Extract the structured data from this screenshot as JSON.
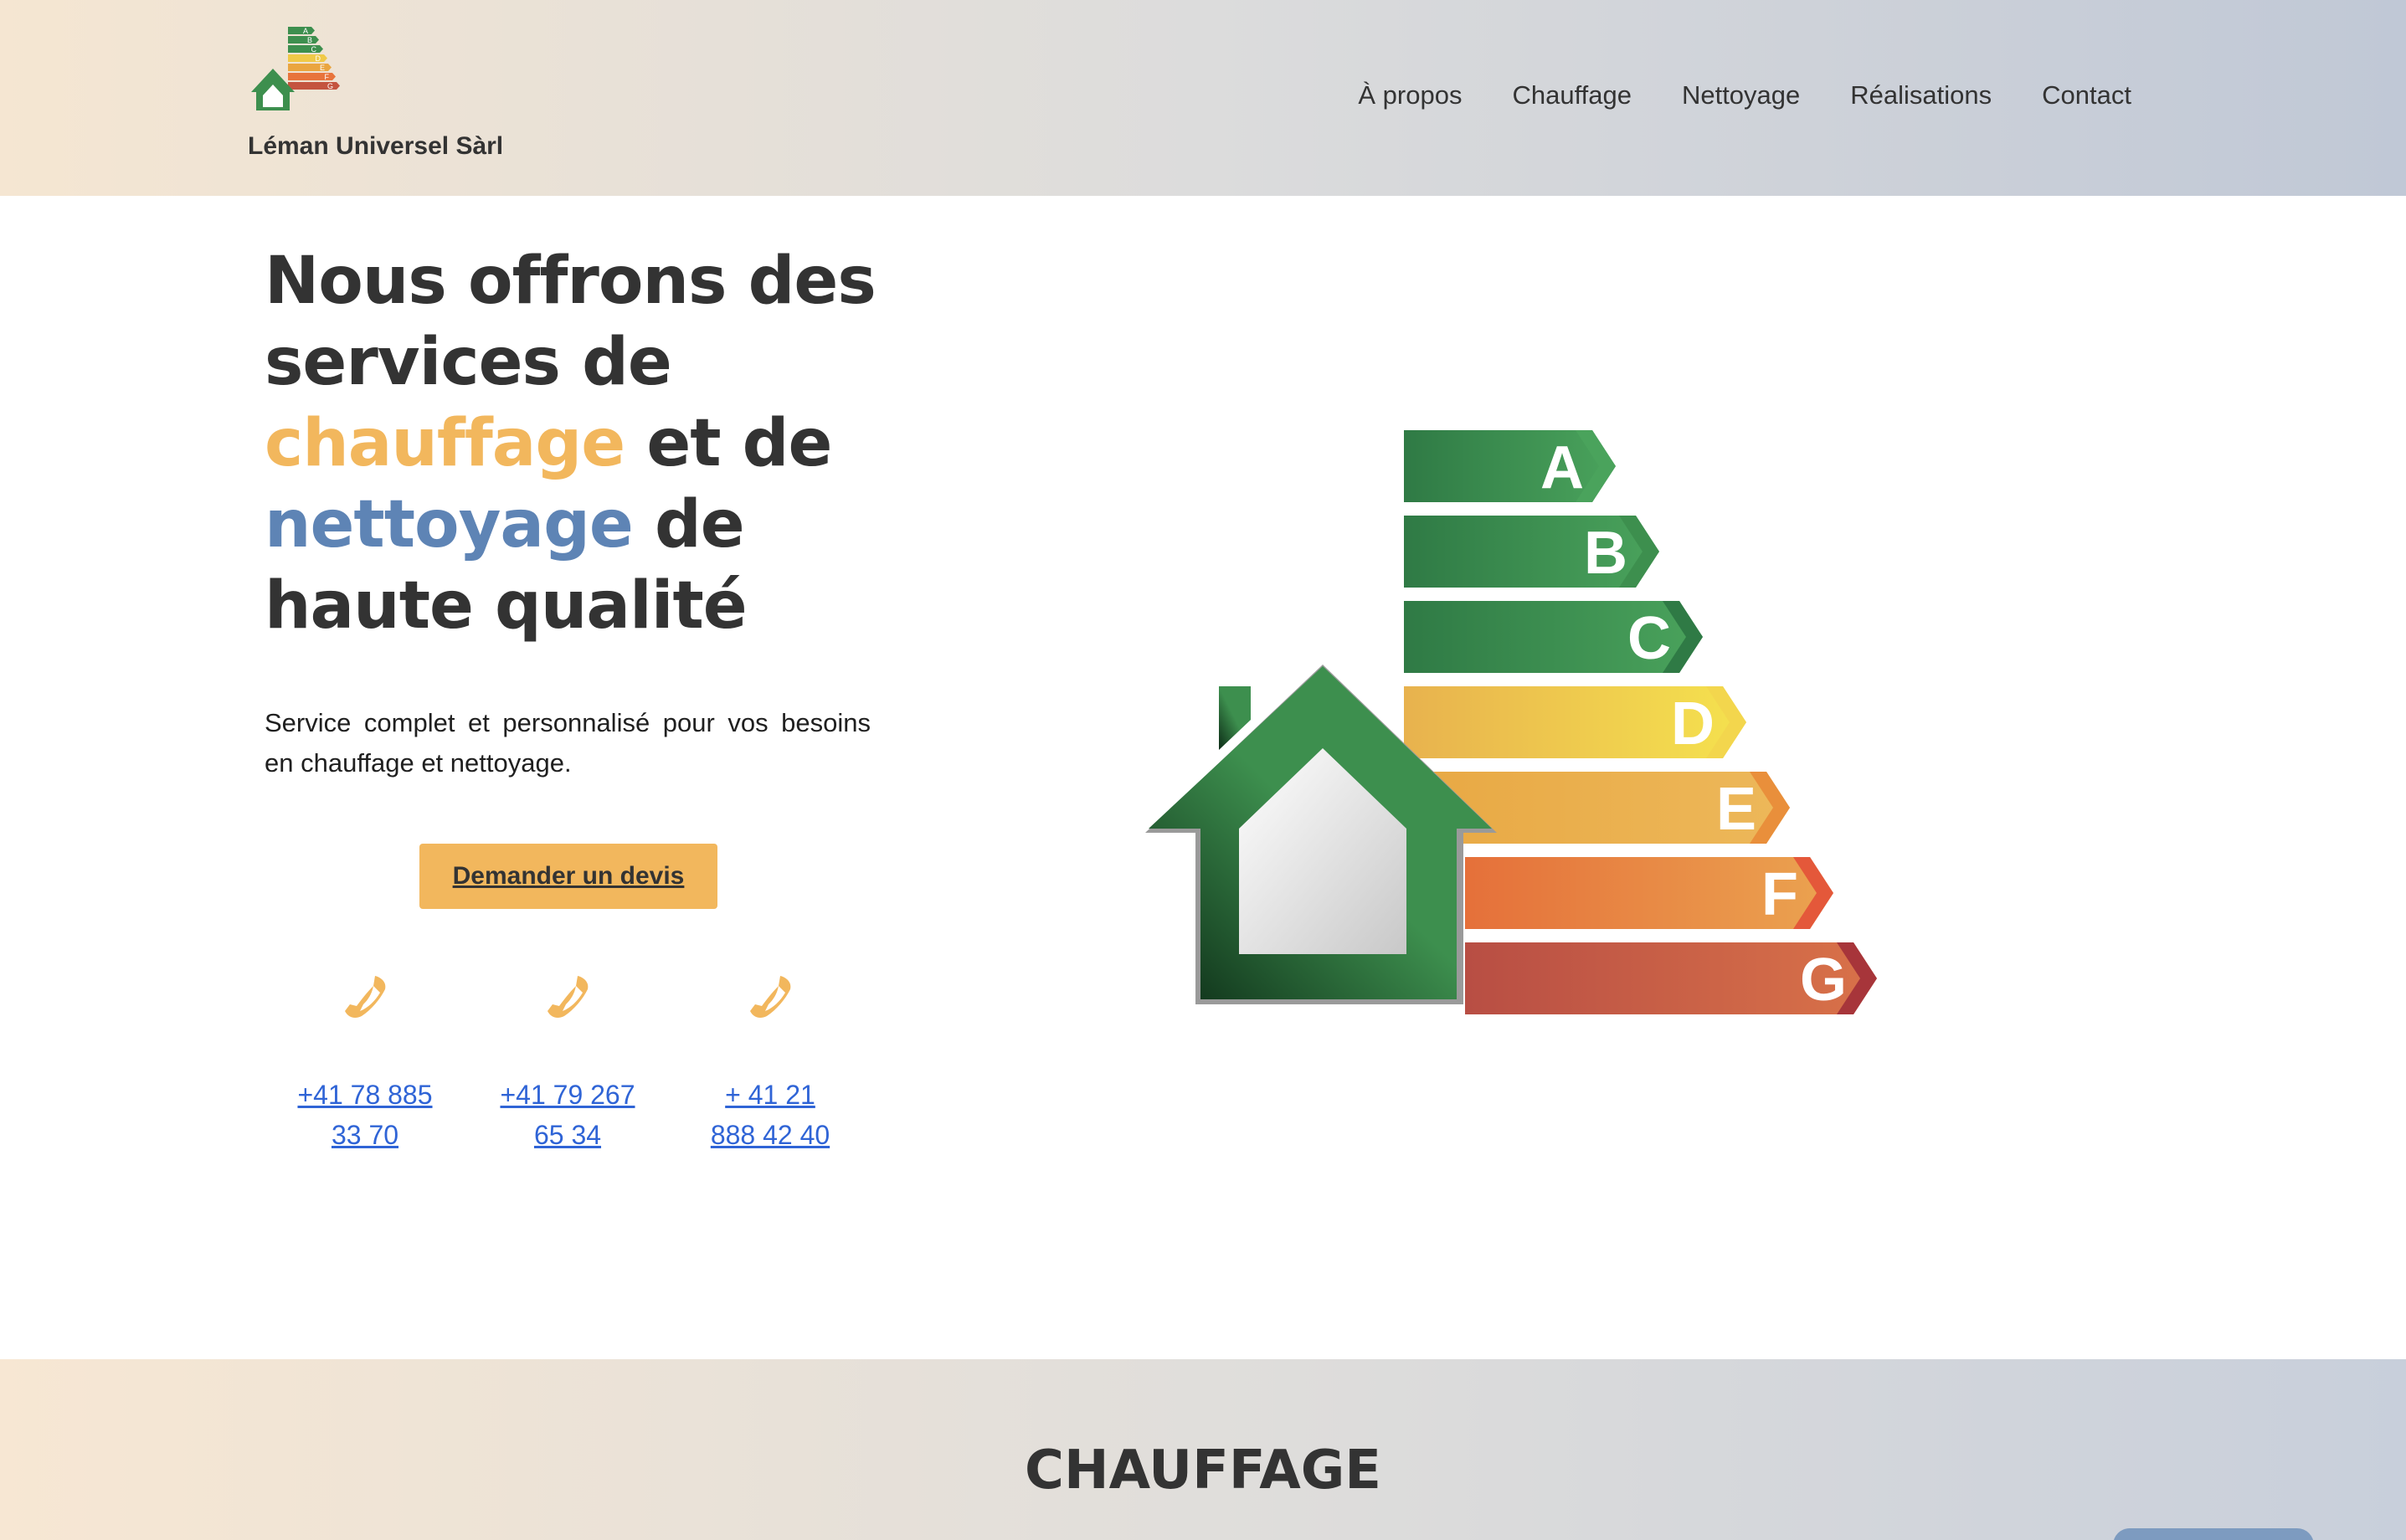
{
  "brand": {
    "name": "Léman Universel Sàrl"
  },
  "nav": {
    "items": [
      "À propos",
      "Chauffage",
      "Nettoyage",
      "Réalisations",
      "Contact"
    ]
  },
  "hero": {
    "title_line1": "Nous offrons des",
    "title_line2": "services de",
    "title_hl1": "chauffage",
    "title_line3_rest": " et de",
    "title_hl2": "nettoyage",
    "title_line4_rest": " de",
    "title_line5": "haute qualité",
    "subtitle": "Service complet et personnalisé pour vos besoins en chauffage et nettoyage.",
    "cta_label": "Demander un devis"
  },
  "phones": [
    {
      "line1": "+41 78 885",
      "line2": "33 70",
      "icon": "phone-icon"
    },
    {
      "line1": "+41 79 267",
      "line2": "65 34",
      "icon": "phone-icon"
    },
    {
      "line1": "+ 41 21",
      "line2": "888 42 40",
      "icon": "phone-icon"
    }
  ],
  "energy_label": {
    "classes": [
      "A",
      "B",
      "C",
      "D",
      "E",
      "F",
      "G"
    ],
    "logo_classes": [
      "A",
      "B",
      "C",
      "D",
      "E",
      "F",
      "G"
    ]
  },
  "section": {
    "title": "CHAUFFAGE"
  },
  "colors": {
    "accent_orange": "#f2b75d",
    "accent_blue": "#5e84b5",
    "link_blue": "#2f64d6"
  }
}
